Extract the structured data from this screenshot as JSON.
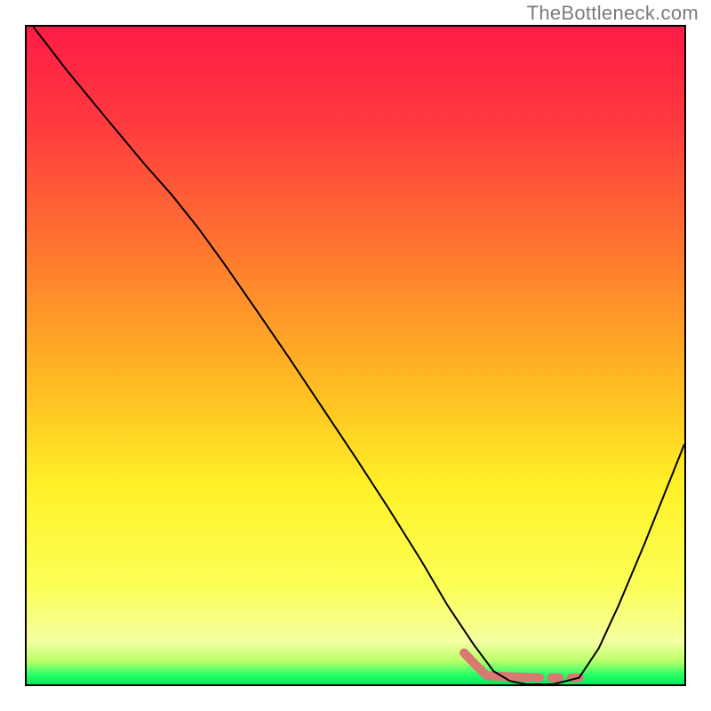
{
  "watermark": "TheBottleneck.com",
  "chart_data": {
    "type": "line",
    "title": "",
    "xlabel": "",
    "ylabel": "",
    "xlim": [
      0,
      1
    ],
    "ylim": [
      0,
      1
    ],
    "gradient_stops": [
      {
        "offset": 0.0,
        "color": "#ff1b45"
      },
      {
        "offset": 0.15,
        "color": "#ff3b3f"
      },
      {
        "offset": 0.35,
        "color": "#ff7a2f"
      },
      {
        "offset": 0.55,
        "color": "#ffbd22"
      },
      {
        "offset": 0.7,
        "color": "#fff128"
      },
      {
        "offset": 0.85,
        "color": "#fcff56"
      },
      {
        "offset": 0.935,
        "color": "#f4ffa0"
      },
      {
        "offset": 0.965,
        "color": "#b8ff6a"
      },
      {
        "offset": 0.985,
        "color": "#2bff66"
      },
      {
        "offset": 1.0,
        "color": "#00e85e"
      }
    ],
    "series": [
      {
        "name": "curve",
        "points": [
          {
            "x": 0.01,
            "y": 1.0
          },
          {
            "x": 0.06,
            "y": 0.935
          },
          {
            "x": 0.12,
            "y": 0.862
          },
          {
            "x": 0.18,
            "y": 0.79
          },
          {
            "x": 0.22,
            "y": 0.745
          },
          {
            "x": 0.26,
            "y": 0.695
          },
          {
            "x": 0.3,
            "y": 0.64
          },
          {
            "x": 0.35,
            "y": 0.568
          },
          {
            "x": 0.4,
            "y": 0.495
          },
          {
            "x": 0.45,
            "y": 0.42
          },
          {
            "x": 0.5,
            "y": 0.345
          },
          {
            "x": 0.55,
            "y": 0.268
          },
          {
            "x": 0.6,
            "y": 0.188
          },
          {
            "x": 0.64,
            "y": 0.12
          },
          {
            "x": 0.68,
            "y": 0.06
          },
          {
            "x": 0.71,
            "y": 0.02
          },
          {
            "x": 0.735,
            "y": 0.005
          },
          {
            "x": 0.76,
            "y": 0.0
          },
          {
            "x": 0.8,
            "y": 0.0
          },
          {
            "x": 0.84,
            "y": 0.01
          },
          {
            "x": 0.87,
            "y": 0.055
          },
          {
            "x": 0.9,
            "y": 0.12
          },
          {
            "x": 0.94,
            "y": 0.215
          },
          {
            "x": 0.98,
            "y": 0.315
          },
          {
            "x": 1.0,
            "y": 0.365
          }
        ]
      }
    ],
    "dash": {
      "name": "bottom-dash",
      "color": "#d77a72",
      "width": 10,
      "segments": [
        {
          "x0": 0.665,
          "y0": 0.048,
          "x1": 0.688,
          "y1": 0.024
        },
        {
          "x0": 0.688,
          "y0": 0.024,
          "x1": 0.7,
          "y1": 0.013
        },
        {
          "x0": 0.7,
          "y0": 0.013,
          "x1": 0.78,
          "y1": 0.01
        },
        {
          "x0": 0.798,
          "y0": 0.01,
          "x1": 0.81,
          "y1": 0.01
        },
        {
          "x0": 0.828,
          "y0": 0.01,
          "x1": 0.84,
          "y1": 0.01
        }
      ]
    }
  }
}
